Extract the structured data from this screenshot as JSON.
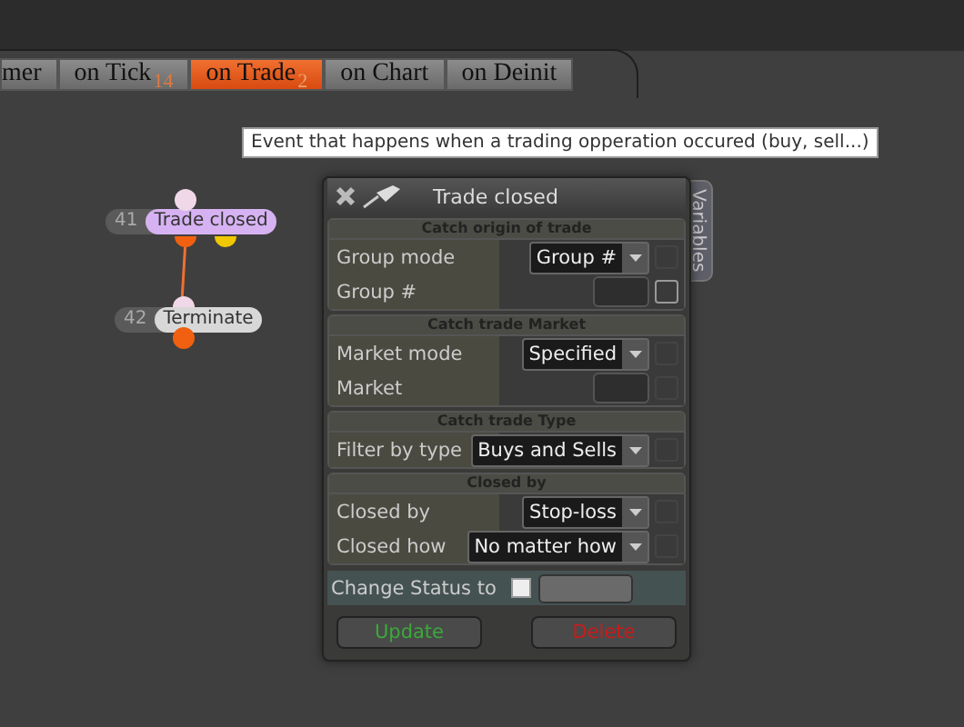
{
  "tabs": [
    {
      "label": "mer",
      "selected": false
    },
    {
      "label": "on Tick",
      "badge": "14",
      "selected": false
    },
    {
      "label": "on Trade",
      "badge": "2",
      "selected": true
    },
    {
      "label": "on Chart",
      "selected": false
    },
    {
      "label": "on Deinit",
      "selected": false
    }
  ],
  "tooltip": "Event that happens when a trading opperation occured (buy, sell...)",
  "nodes": [
    {
      "number": "41",
      "label": "Trade closed",
      "color": "#d6b2f2"
    },
    {
      "number": "42",
      "label": "Terminate",
      "color": "#d8d8d8"
    }
  ],
  "dialog": {
    "title": "Trade closed",
    "side_tab": "Variables",
    "sections": [
      {
        "title": "Catch origin of trade",
        "rows": [
          {
            "kind": "select",
            "label": "Group mode",
            "value": "Group #",
            "checkbox_disabled": true
          },
          {
            "kind": "input",
            "label": "Group #",
            "checkbox_disabled": false
          }
        ]
      },
      {
        "title": "Catch trade Market",
        "rows": [
          {
            "kind": "select",
            "label": "Market mode",
            "value": "Specified",
            "checkbox_disabled": true
          },
          {
            "kind": "input",
            "label": "Market",
            "checkbox_disabled": true
          }
        ]
      },
      {
        "title": "Catch trade Type",
        "rows": [
          {
            "kind": "select",
            "label": "Filter by type",
            "value": "Buys and Sells",
            "checkbox_disabled": true
          }
        ]
      },
      {
        "title": "Closed by",
        "rows": [
          {
            "kind": "select",
            "label": "Closed by",
            "value": "Stop-loss",
            "checkbox_disabled": true
          },
          {
            "kind": "select",
            "label": "Closed how",
            "value": "No matter how",
            "checkbox_disabled": true
          }
        ]
      }
    ],
    "status": {
      "label": "Change Status to",
      "checked": false
    },
    "buttons": [
      {
        "label": "Update",
        "kind": "update"
      },
      {
        "label": "Delete",
        "kind": "delete"
      }
    ]
  }
}
